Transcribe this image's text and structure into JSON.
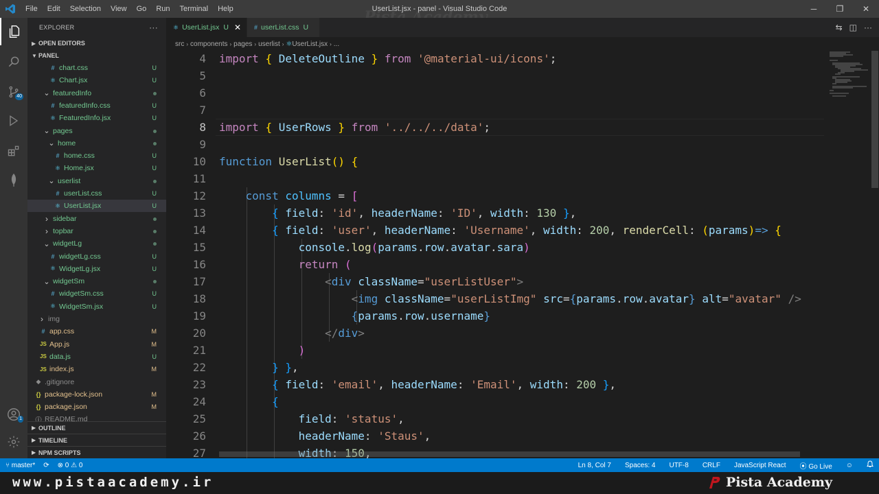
{
  "titlebar": {
    "menu": [
      "File",
      "Edit",
      "Selection",
      "View",
      "Go",
      "Run",
      "Terminal",
      "Help"
    ],
    "title": "UserList.jsx - panel - Visual Studio Code",
    "watermark": "Pista Academy",
    "minimize": "─",
    "maximize": "❐",
    "close": "✕"
  },
  "sidebar": {
    "title": "EXPLORER",
    "more": "···",
    "open_editors": "OPEN EDITORS",
    "workspace": "PANEL",
    "tree": [
      {
        "name": "chart.css",
        "icon": "#",
        "kind": "css",
        "git": "U",
        "depth": 4
      },
      {
        "name": "Chart.jsx",
        "icon": "⚛",
        "kind": "jsx",
        "git": "U",
        "depth": 4
      },
      {
        "name": "featuredInfo",
        "icon": "",
        "kind": "folder-open",
        "git": "dot",
        "depth": 3
      },
      {
        "name": "featuredInfo.css",
        "icon": "#",
        "kind": "css",
        "git": "U",
        "depth": 4
      },
      {
        "name": "FeaturedInfo.jsx",
        "icon": "⚛",
        "kind": "jsx",
        "git": "U",
        "depth": 4
      },
      {
        "name": "pages",
        "icon": "",
        "kind": "folder-open",
        "git": "dot",
        "depth": 3
      },
      {
        "name": "home",
        "icon": "",
        "kind": "folder-open",
        "git": "dot",
        "depth": 4
      },
      {
        "name": "home.css",
        "icon": "#",
        "kind": "css",
        "git": "U",
        "depth": 5
      },
      {
        "name": "Home.jsx",
        "icon": "⚛",
        "kind": "jsx",
        "git": "U",
        "depth": 5
      },
      {
        "name": "userlist",
        "icon": "",
        "kind": "folder-open",
        "git": "dot",
        "depth": 4
      },
      {
        "name": "userList.css",
        "icon": "#",
        "kind": "css",
        "git": "U",
        "depth": 5
      },
      {
        "name": "UserList.jsx",
        "icon": "⚛",
        "kind": "jsx",
        "git": "U",
        "depth": 5,
        "selected": true
      },
      {
        "name": "sidebar",
        "icon": "",
        "kind": "folder-closed",
        "git": "dot",
        "depth": 3
      },
      {
        "name": "topbar",
        "icon": "",
        "kind": "folder-closed",
        "git": "dot",
        "depth": 3
      },
      {
        "name": "widgetLg",
        "icon": "",
        "kind": "folder-open",
        "git": "dot",
        "depth": 3
      },
      {
        "name": "widgetLg.css",
        "icon": "#",
        "kind": "css",
        "git": "U",
        "depth": 4
      },
      {
        "name": "WidgetLg.jsx",
        "icon": "⚛",
        "kind": "jsx",
        "git": "U",
        "depth": 4
      },
      {
        "name": "widgetSm",
        "icon": "",
        "kind": "folder-open",
        "git": "dot",
        "depth": 3
      },
      {
        "name": "widgetSm.css",
        "icon": "#",
        "kind": "css",
        "git": "U",
        "depth": 4
      },
      {
        "name": "WidgetSm.jsx",
        "icon": "⚛",
        "kind": "jsx",
        "git": "U",
        "depth": 4
      },
      {
        "name": "img",
        "icon": "",
        "kind": "folder-closed",
        "git": "",
        "depth": 2
      },
      {
        "name": "app.css",
        "icon": "#",
        "kind": "css-mod",
        "git": "M",
        "depth": 2
      },
      {
        "name": "App.js",
        "icon": "JS",
        "kind": "js-mod",
        "git": "M",
        "depth": 2
      },
      {
        "name": "data.js",
        "icon": "JS",
        "kind": "js",
        "git": "U",
        "depth": 2
      },
      {
        "name": "index.js",
        "icon": "JS",
        "kind": "js-mod",
        "git": "M",
        "depth": 2
      },
      {
        "name": ".gitignore",
        "icon": "◆",
        "kind": "plain",
        "git": "",
        "depth": 1
      },
      {
        "name": "package-lock.json",
        "icon": "{}",
        "kind": "json",
        "git": "M",
        "depth": 1
      },
      {
        "name": "package.json",
        "icon": "{}",
        "kind": "json",
        "git": "M",
        "depth": 1
      },
      {
        "name": "README.md",
        "icon": "ⓘ",
        "kind": "plain",
        "git": "",
        "depth": 1
      }
    ],
    "outline": "OUTLINE",
    "timeline": "TIMELINE",
    "npm": "NPM SCRIPTS"
  },
  "tabs": [
    {
      "icon": "⚛",
      "label": "UserList.jsx",
      "git": "U",
      "active": true,
      "close": "✕"
    },
    {
      "icon": "#",
      "label": "userList.css",
      "git": "U",
      "active": false,
      "close": ""
    }
  ],
  "breadcrumb": [
    "src",
    "components",
    "pages",
    "userlist",
    "UserList.jsx",
    "..."
  ],
  "editor": {
    "line_numbers": [
      4,
      5,
      6,
      7,
      8,
      9,
      10,
      11,
      12,
      13,
      14,
      15,
      16,
      17,
      18,
      19,
      20,
      21,
      22,
      23,
      24,
      25,
      26,
      27
    ],
    "current_line": 8,
    "lines": [
      [
        [
          "kw",
          "import"
        ],
        [
          "pl",
          " "
        ],
        [
          "br1",
          "{"
        ],
        [
          "pl",
          " "
        ],
        [
          "var",
          "DeleteOutline"
        ],
        [
          "pl",
          " "
        ],
        [
          "br1",
          "}"
        ],
        [
          "pl",
          " "
        ],
        [
          "kw",
          "from"
        ],
        [
          "pl",
          " "
        ],
        [
          "str",
          "'@material-ui/icons'"
        ],
        [
          "pl",
          ";"
        ]
      ],
      [],
      [],
      [],
      [
        [
          "kw",
          "import"
        ],
        [
          "pl",
          " "
        ],
        [
          "br1",
          "{"
        ],
        [
          "pl",
          " "
        ],
        [
          "var",
          "UserRows"
        ],
        [
          "pl",
          " "
        ],
        [
          "br1",
          "}"
        ],
        [
          "pl",
          " "
        ],
        [
          "kw",
          "from"
        ],
        [
          "pl",
          " "
        ],
        [
          "str",
          "'../../../data'"
        ],
        [
          "pl",
          ";"
        ]
      ],
      [],
      [
        [
          "kw2",
          "function"
        ],
        [
          "pl",
          " "
        ],
        [
          "fn",
          "UserList"
        ],
        [
          "br1",
          "()"
        ],
        [
          "pl",
          " "
        ],
        [
          "br1",
          "{"
        ]
      ],
      [],
      [
        [
          "pl",
          "    "
        ],
        [
          "kw2",
          "const"
        ],
        [
          "pl",
          " "
        ],
        [
          "cvar",
          "columns"
        ],
        [
          "pl",
          " = "
        ],
        [
          "br2",
          "["
        ]
      ],
      [
        [
          "pl",
          "        "
        ],
        [
          "br3",
          "{"
        ],
        [
          "pl",
          " "
        ],
        [
          "var",
          "field"
        ],
        [
          "pl",
          ": "
        ],
        [
          "str",
          "'id'"
        ],
        [
          "pl",
          ", "
        ],
        [
          "var",
          "headerName"
        ],
        [
          "pl",
          ": "
        ],
        [
          "str",
          "'ID'"
        ],
        [
          "pl",
          ", "
        ],
        [
          "var",
          "width"
        ],
        [
          "pl",
          ": "
        ],
        [
          "num",
          "130"
        ],
        [
          "pl",
          " "
        ],
        [
          "br3",
          "}"
        ],
        [
          "pl",
          ","
        ]
      ],
      [
        [
          "pl",
          "        "
        ],
        [
          "br3",
          "{"
        ],
        [
          "pl",
          " "
        ],
        [
          "var",
          "field"
        ],
        [
          "pl",
          ": "
        ],
        [
          "str",
          "'user'"
        ],
        [
          "pl",
          ", "
        ],
        [
          "var",
          "headerName"
        ],
        [
          "pl",
          ": "
        ],
        [
          "str",
          "'Username'"
        ],
        [
          "pl",
          ", "
        ],
        [
          "var",
          "width"
        ],
        [
          "pl",
          ": "
        ],
        [
          "num",
          "200"
        ],
        [
          "pl",
          ", "
        ],
        [
          "fn",
          "renderCell"
        ],
        [
          "pl",
          ": "
        ],
        [
          "br1",
          "("
        ],
        [
          "var",
          "params"
        ],
        [
          "br1",
          ")"
        ],
        [
          "kw2",
          "=>"
        ],
        [
          "pl",
          " "
        ],
        [
          "br1",
          "{"
        ]
      ],
      [
        [
          "pl",
          "            "
        ],
        [
          "var",
          "console"
        ],
        [
          "pl",
          "."
        ],
        [
          "fn",
          "log"
        ],
        [
          "br2",
          "("
        ],
        [
          "var",
          "params"
        ],
        [
          "pl",
          "."
        ],
        [
          "var",
          "row"
        ],
        [
          "pl",
          "."
        ],
        [
          "var",
          "avatar"
        ],
        [
          "pl",
          "."
        ],
        [
          "var",
          "sara"
        ],
        [
          "br2",
          ")"
        ]
      ],
      [
        [
          "pl",
          "            "
        ],
        [
          "kw",
          "return"
        ],
        [
          "pl",
          " "
        ],
        [
          "br2",
          "("
        ]
      ],
      [
        [
          "pl",
          "                "
        ],
        [
          "tagp",
          "<"
        ],
        [
          "tag",
          "div"
        ],
        [
          "pl",
          " "
        ],
        [
          "attr",
          "className"
        ],
        [
          "pl",
          "="
        ],
        [
          "str",
          "\"userListUser\""
        ],
        [
          "tagp",
          ">"
        ]
      ],
      [
        [
          "pl",
          "                    "
        ],
        [
          "tagp",
          "<"
        ],
        [
          "tag",
          "img"
        ],
        [
          "pl",
          " "
        ],
        [
          "attr",
          "className"
        ],
        [
          "pl",
          "="
        ],
        [
          "str",
          "\"userListImg\""
        ],
        [
          "pl",
          " "
        ],
        [
          "attr",
          "src"
        ],
        [
          "pl",
          "="
        ],
        [
          "kw2",
          "{"
        ],
        [
          "var",
          "params"
        ],
        [
          "pl",
          "."
        ],
        [
          "var",
          "row"
        ],
        [
          "pl",
          "."
        ],
        [
          "var",
          "avatar"
        ],
        [
          "kw2",
          "}"
        ],
        [
          "pl",
          " "
        ],
        [
          "attr",
          "alt"
        ],
        [
          "pl",
          "="
        ],
        [
          "str",
          "\"avatar\""
        ],
        [
          "pl",
          " "
        ],
        [
          "tagp",
          "/>"
        ]
      ],
      [
        [
          "pl",
          "                    "
        ],
        [
          "kw2",
          "{"
        ],
        [
          "var",
          "params"
        ],
        [
          "pl",
          "."
        ],
        [
          "var",
          "row"
        ],
        [
          "pl",
          "."
        ],
        [
          "var",
          "username"
        ],
        [
          "kw2",
          "}"
        ]
      ],
      [
        [
          "pl",
          "                "
        ],
        [
          "tagp",
          "</"
        ],
        [
          "tag",
          "div"
        ],
        [
          "tagp",
          ">"
        ]
      ],
      [
        [
          "pl",
          "            "
        ],
        [
          "br2",
          ")"
        ]
      ],
      [
        [
          "pl",
          "        "
        ],
        [
          "br3",
          "}"
        ],
        [
          "pl",
          " "
        ],
        [
          "br3",
          "}"
        ],
        [
          "pl",
          ","
        ]
      ],
      [
        [
          "pl",
          "        "
        ],
        [
          "br3",
          "{"
        ],
        [
          "pl",
          " "
        ],
        [
          "var",
          "field"
        ],
        [
          "pl",
          ": "
        ],
        [
          "str",
          "'email'"
        ],
        [
          "pl",
          ", "
        ],
        [
          "var",
          "headerName"
        ],
        [
          "pl",
          ": "
        ],
        [
          "str",
          "'Email'"
        ],
        [
          "pl",
          ", "
        ],
        [
          "var",
          "width"
        ],
        [
          "pl",
          ": "
        ],
        [
          "num",
          "200"
        ],
        [
          "pl",
          " "
        ],
        [
          "br3",
          "}"
        ],
        [
          "pl",
          ","
        ]
      ],
      [
        [
          "pl",
          "        "
        ],
        [
          "br3",
          "{"
        ]
      ],
      [
        [
          "pl",
          "            "
        ],
        [
          "var",
          "field"
        ],
        [
          "pl",
          ": "
        ],
        [
          "str",
          "'status'"
        ],
        [
          "pl",
          ","
        ]
      ],
      [
        [
          "pl",
          "            "
        ],
        [
          "var",
          "headerName"
        ],
        [
          "pl",
          ": "
        ],
        [
          "str",
          "'Staus'"
        ],
        [
          "pl",
          ","
        ]
      ],
      [
        [
          "pl",
          "            "
        ],
        [
          "var",
          "width"
        ],
        [
          "pl",
          ": "
        ],
        [
          "num",
          "150"
        ],
        [
          "pl",
          ","
        ]
      ]
    ]
  },
  "statusbar": {
    "branch": "master*",
    "sync": "⟳",
    "problems": "⊗ 0 ⚠ 0",
    "position": "Ln 8, Col 7",
    "spaces": "Spaces: 4",
    "encoding": "UTF-8",
    "eol": "CRLF",
    "language": "JavaScript React",
    "golive": "Go Live",
    "feedback": "☺",
    "bell": "🔔"
  },
  "footer": {
    "url": "www.pistaacademy.ir",
    "brand": "Pista Academy",
    "brand_color": "#c0161e"
  },
  "colors": {
    "accent": "#007acc",
    "untracked": "#73c991",
    "modified": "#e2c08d"
  }
}
